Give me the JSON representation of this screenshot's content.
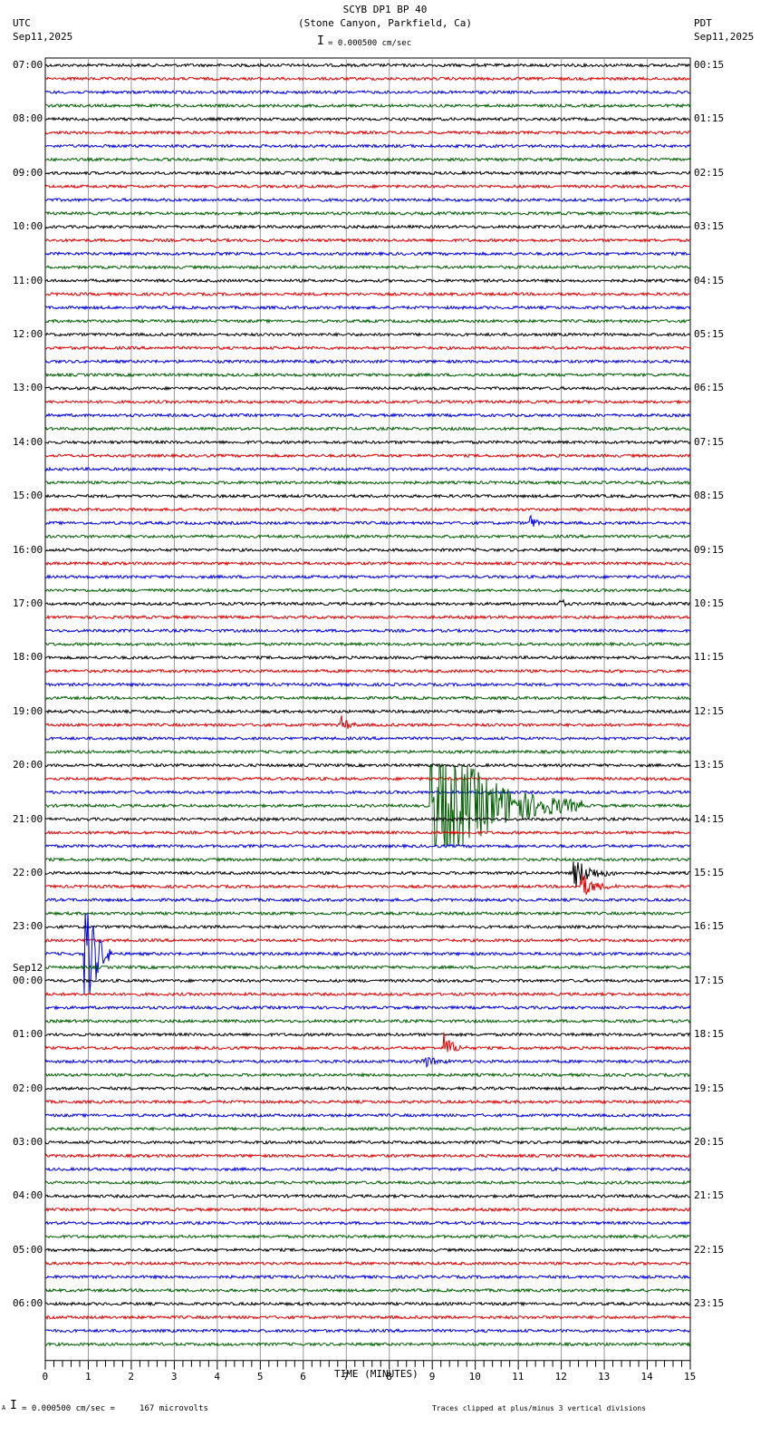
{
  "header": {
    "title": "SCYB DP1 BP 40",
    "subtitle": "(Stone Canyon, Parkfield, Ca)",
    "left_tz": "UTC",
    "left_date": "Sep11,2025",
    "right_tz": "PDT",
    "right_date": "Sep11,2025",
    "scale": "= 0.000500 cm/sec"
  },
  "footer": {
    "scale": "= 0.000500 cm/sec =     167 microvolts",
    "clip_note": "Traces clipped at plus/minus 3 vertical divisions",
    "mark": "A"
  },
  "chart_data": {
    "type": "seismogram",
    "xlabel": "TIME (MINUTES)",
    "xlim": [
      0,
      15
    ],
    "xticks": [
      "0",
      "1",
      "2",
      "3",
      "4",
      "5",
      "6",
      "7",
      "8",
      "9",
      "10",
      "11",
      "12",
      "13",
      "14",
      "15"
    ],
    "traces_per_hour": 4,
    "trace_colors": [
      "#000000",
      "#e00000",
      "#0000e0",
      "#006000"
    ],
    "left_labels": [
      "07:00",
      "08:00",
      "09:00",
      "10:00",
      "11:00",
      "12:00",
      "13:00",
      "14:00",
      "15:00",
      "16:00",
      "17:00",
      "18:00",
      "19:00",
      "20:00",
      "21:00",
      "22:00",
      "23:00",
      "00:00",
      "01:00",
      "02:00",
      "03:00",
      "04:00",
      "05:00",
      "06:00"
    ],
    "left_date_change": {
      "hour_index": 17,
      "label": "Sep12"
    },
    "right_labels": [
      "00:15",
      "01:15",
      "02:15",
      "03:15",
      "04:15",
      "05:15",
      "06:15",
      "07:15",
      "08:15",
      "09:15",
      "10:15",
      "11:15",
      "12:15",
      "13:15",
      "14:15",
      "15:15",
      "16:15",
      "17:15",
      "18:15",
      "19:15",
      "20:15",
      "21:15",
      "22:15",
      "23:15"
    ],
    "events": [
      {
        "trace": 55,
        "minute": 9.0,
        "amplitude": 6,
        "duration": 3.5
      },
      {
        "trace": 60,
        "minute": 12.3,
        "amplitude": 1.2,
        "duration": 1.0
      },
      {
        "trace": 61,
        "minute": 12.5,
        "amplitude": 0.8,
        "duration": 0.8
      },
      {
        "trace": 66,
        "minute": 0.95,
        "amplitude": 6,
        "duration": 0.6
      },
      {
        "trace": 73,
        "minute": 9.3,
        "amplitude": 1.0,
        "duration": 0.5
      },
      {
        "trace": 74,
        "minute": 8.8,
        "amplitude": 0.4,
        "duration": 0.7
      },
      {
        "trace": 49,
        "minute": 6.9,
        "amplitude": 0.6,
        "duration": 0.4
      },
      {
        "trace": 40,
        "minute": 12.0,
        "amplitude": 1.0,
        "duration": 0.1
      },
      {
        "trace": 34,
        "minute": 11.3,
        "amplitude": 0.5,
        "duration": 0.3
      }
    ]
  }
}
